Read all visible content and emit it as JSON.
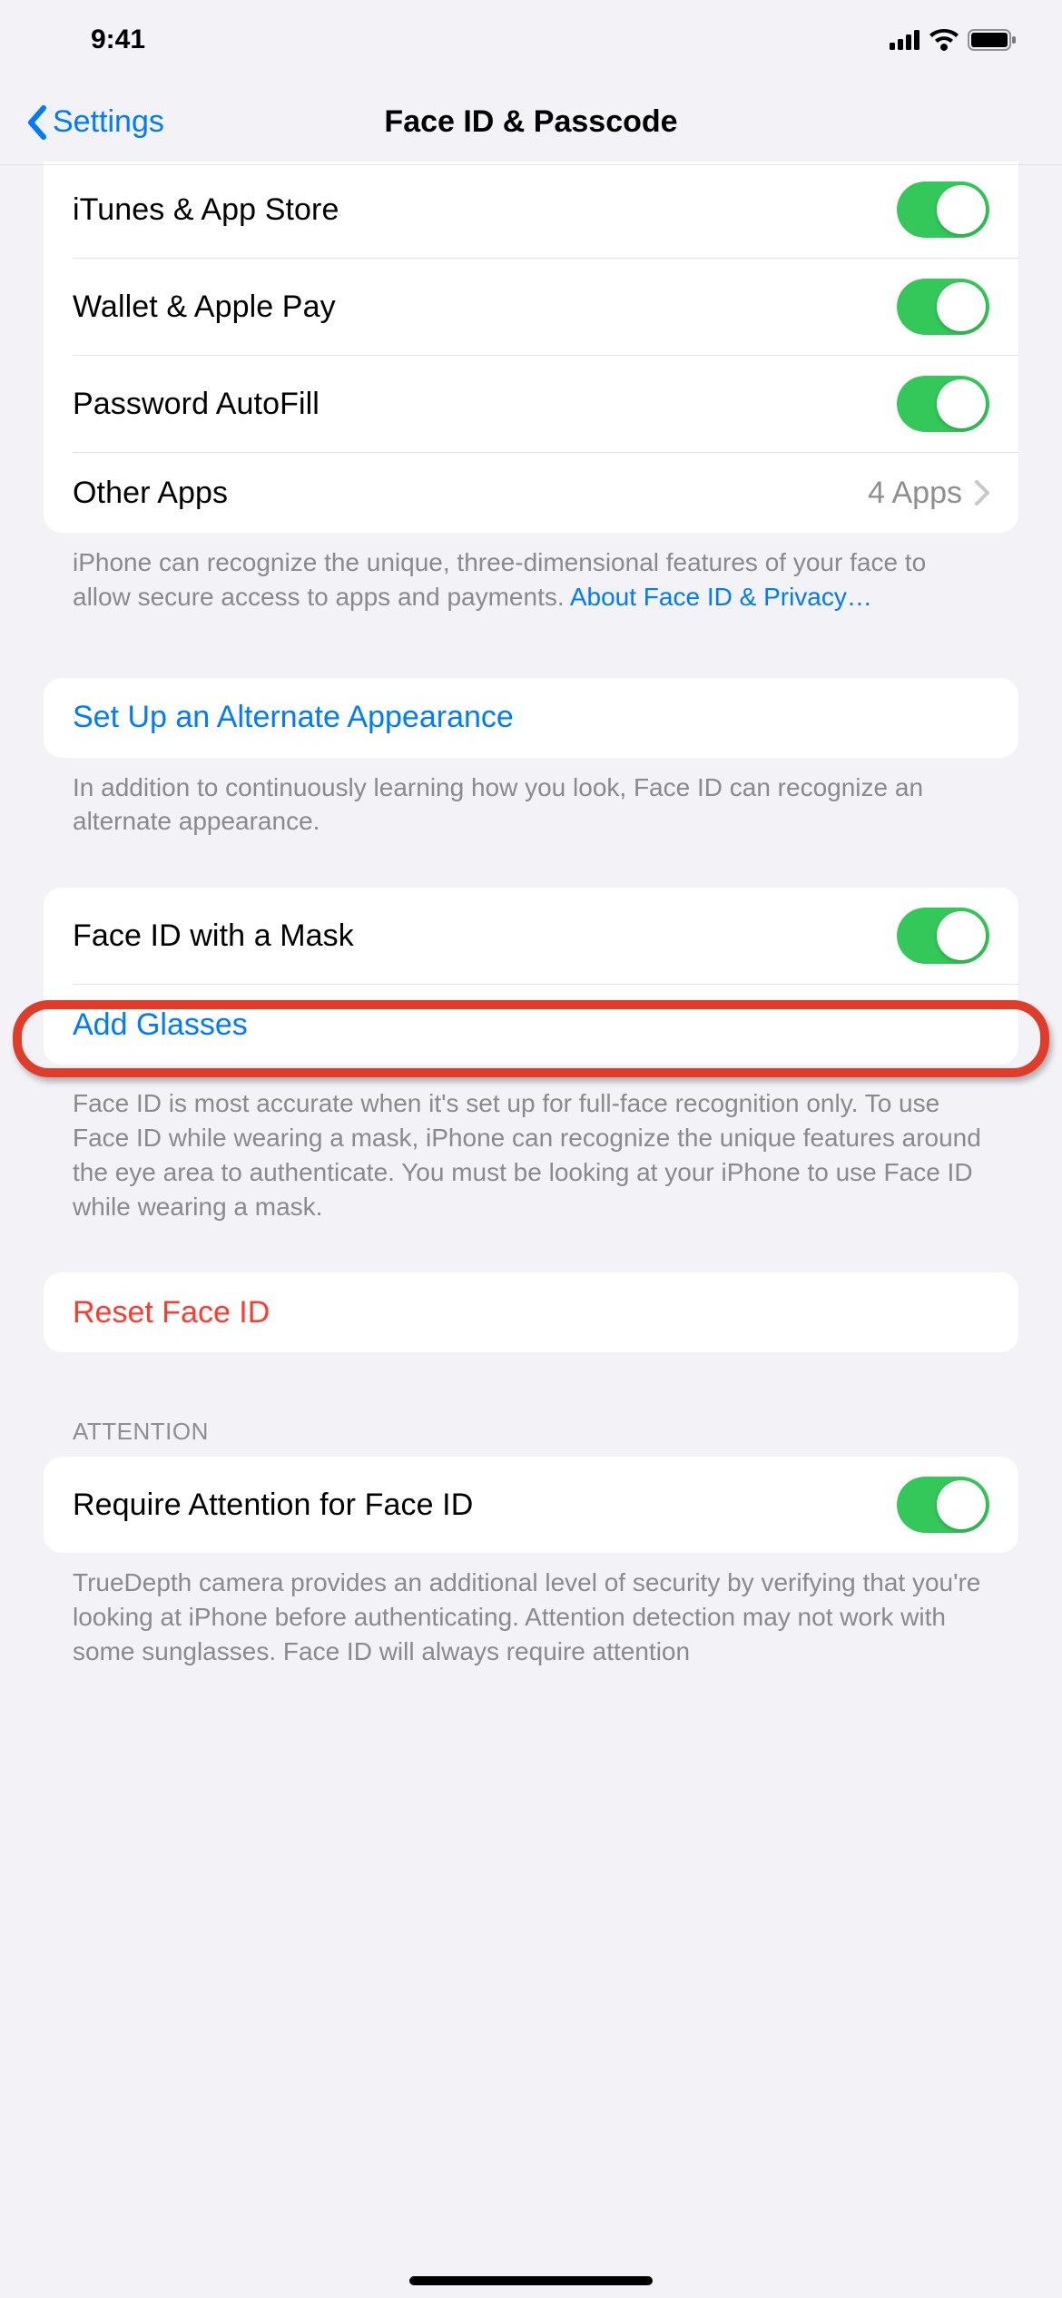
{
  "statusBar": {
    "time": "9:41"
  },
  "nav": {
    "back": "Settings",
    "title": "Face ID & Passcode"
  },
  "section1": {
    "rows": [
      {
        "label": "iTunes & App Store"
      },
      {
        "label": "Wallet & Apple Pay"
      },
      {
        "label": "Password AutoFill"
      }
    ],
    "otherApps": {
      "label": "Other Apps",
      "detail": "4 Apps"
    },
    "footer_text": "iPhone can recognize the unique, three-dimensional features of your face to allow secure access to apps and payments. ",
    "footer_link": "About Face ID & Privacy…"
  },
  "section2": {
    "action": "Set Up an Alternate Appearance",
    "footer": "In addition to continuously learning how you look, Face ID can recognize an alternate appearance."
  },
  "section3": {
    "mask": "Face ID with a Mask",
    "glasses": "Add Glasses",
    "footer": "Face ID is most accurate when it's set up for full-face recognition only. To use Face ID while wearing a mask, iPhone can recognize the unique features around the eye area to authenticate. You must be looking at your iPhone to use Face ID while wearing a mask."
  },
  "section4": {
    "reset": "Reset Face ID"
  },
  "section5": {
    "header": "ATTENTION",
    "require": "Require Attention for Face ID",
    "footer": "TrueDepth camera provides an additional level of security by verifying that you're looking at iPhone before authenticating. Attention detection may not work with some sunglasses. Face ID will always require attention"
  }
}
